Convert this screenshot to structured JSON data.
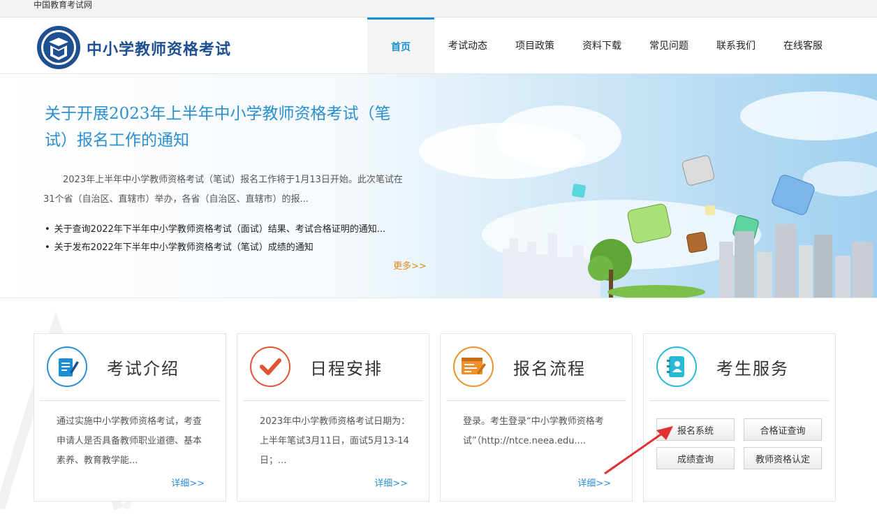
{
  "topbar": {
    "site_link": "中国教育考试网"
  },
  "header": {
    "brand": "中小学教师资格考试",
    "nav": [
      "首页",
      "考试动态",
      "项目政策",
      "资料下载",
      "常见问题",
      "联系我们",
      "在线客服"
    ]
  },
  "banner": {
    "title": "关于开展2023年上半年中小学教师资格考试（笔试）报名工作的通知",
    "summary": "2023年上半年中小学教师资格考试（笔试）报名工作将于1月13日开始。此次笔试在31个省（自治区、直辖市）举办，各省（自治区、直辖市）的报...",
    "links": [
      "关于查询2022年下半年中小学教师资格考试（面试）结果、考试合格证明的通知...",
      "关于发布2022年下半年中小学教师资格考试（笔试）成绩的通知"
    ],
    "more": "更多>>"
  },
  "cards": [
    {
      "title": "考试介绍",
      "desc": "通过实施中小学教师资格考试，考查申请人是否具备教师职业道德、基本素养、教育教学能...",
      "detail": "详细>>"
    },
    {
      "title": "日程安排",
      "desc": "2023年中小学教师资格考试日期为：上半年笔试3月11日，面试5月13-14日；...",
      "detail": "详细>>"
    },
    {
      "title": "报名流程",
      "desc": "登录。考生登录“中小学教师资格考试”（http://ntce.neea.edu....",
      "detail": "详细>>"
    },
    {
      "title": "考生服务"
    }
  ],
  "services": [
    "报名系统",
    "合格证查询",
    "成绩查询",
    "教师资格认定"
  ],
  "colors": {
    "accent": "#1a8fd6",
    "brand": "#1d4f91",
    "more_orange": "#e08a19",
    "red_icon": "#e2542f",
    "orange_icon": "#f0902a",
    "cyan_icon": "#28b8d8",
    "arrow_red": "#e03030"
  },
  "icons": [
    "document-edit-icon",
    "checkmark-icon",
    "registration-form-icon",
    "contact-book-icon",
    "red-arrow-annotation"
  ]
}
